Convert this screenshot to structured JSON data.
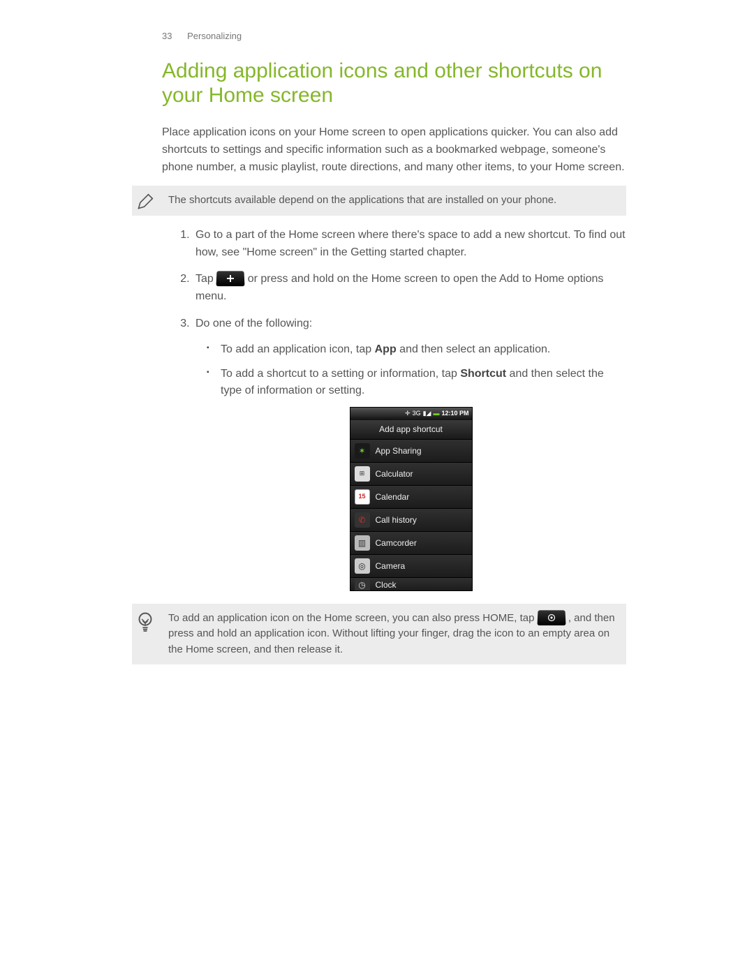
{
  "header": {
    "page_number": "33",
    "section": "Personalizing"
  },
  "title": "Adding application icons and other shortcuts on your Home screen",
  "intro": "Place application icons on your Home screen to open applications quicker. You can also add shortcuts to settings and specific information such as a bookmarked webpage, someone's phone number, a music playlist, route directions, and many other items, to your Home screen.",
  "note": "The shortcuts available depend on the applications that are installed on your phone.",
  "steps": {
    "s1": "Go to a part of the Home screen where there's space to add a new shortcut. To find out how, see \"Home screen\" in the Getting started chapter.",
    "s2a": "Tap ",
    "s2b": " or press and hold on the Home screen to open the Add to Home options menu.",
    "s3": "Do one of the following:",
    "bullet1a": "To add an application icon, tap ",
    "bullet1_bold": "App",
    "bullet1b": " and then select an application.",
    "bullet2a": "To add a shortcut to a setting or information, tap ",
    "bullet2_bold": "Shortcut",
    "bullet2b": " and then select the type of information or setting."
  },
  "phone": {
    "time": "12:10 PM",
    "signal_label": "3G",
    "title": "Add app shortcut",
    "apps": {
      "a0": "App Sharing",
      "a1": "Calculator",
      "a2": "Calendar",
      "a3": "Call history",
      "a4": "Camcorder",
      "a5": "Camera",
      "a6": "Clock"
    }
  },
  "tip": {
    "t1": "To add an application icon on the Home screen, you can also press HOME, tap ",
    "t2": ", and then press and hold an application icon. Without lifting your finger, drag the icon to an empty area on the Home screen, and then release it."
  }
}
